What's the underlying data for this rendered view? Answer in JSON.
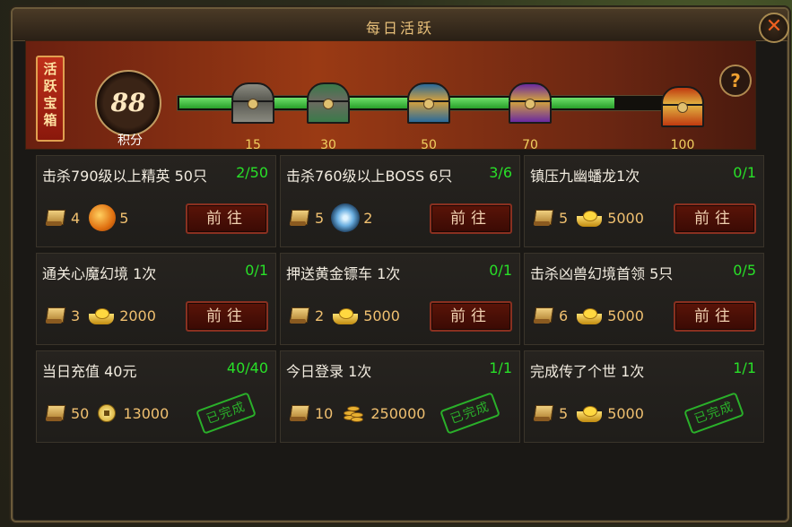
{
  "window": {
    "title": "每日活跃",
    "close_icon": "close-icon"
  },
  "banner": {
    "tag_text": "活跃宝箱",
    "points": "88",
    "points_label": "积分",
    "progress_fraction": 0.88,
    "milestones": [
      {
        "value": "15",
        "color": "#8a8a80",
        "accent": "#5a5a52"
      },
      {
        "value": "30",
        "color": "#3a7a4a",
        "accent": "#6a6a60"
      },
      {
        "value": "50",
        "color": "#2a6a9a",
        "accent": "#d0a040"
      },
      {
        "value": "70",
        "color": "#6a2aa0",
        "accent": "#d0a040"
      },
      {
        "value": "100",
        "color": "#c03a10",
        "accent": "#e0b040"
      }
    ],
    "help_label": "?"
  },
  "tasks": [
    {
      "name": "击杀790级以上精英 50只",
      "progress": "2/50",
      "rewards": [
        {
          "icon": "scroll-icon",
          "amount": "4"
        },
        {
          "icon": "fire-gem-icon",
          "amount": "5"
        }
      ],
      "action": "前往"
    },
    {
      "name": "击杀760级以上BOSS 6只",
      "progress": "3/6",
      "rewards": [
        {
          "icon": "scroll-icon",
          "amount": "5"
        },
        {
          "icon": "ice-gem-icon",
          "amount": "2"
        }
      ],
      "action": "前往"
    },
    {
      "name": "镇压九幽蟠龙1次",
      "progress": "0/1",
      "rewards": [
        {
          "icon": "scroll-icon",
          "amount": "5"
        },
        {
          "icon": "gold-ingot-icon",
          "amount": "5000"
        }
      ],
      "action": "前往"
    },
    {
      "name": "通关心魔幻境 1次",
      "progress": "0/1",
      "rewards": [
        {
          "icon": "scroll-icon",
          "amount": "3"
        },
        {
          "icon": "gold-ingot-icon",
          "amount": "2000"
        }
      ],
      "action": "前往"
    },
    {
      "name": "押送黄金镖车 1次",
      "progress": "0/1",
      "rewards": [
        {
          "icon": "scroll-icon",
          "amount": "2"
        },
        {
          "icon": "gold-ingot-icon",
          "amount": "5000"
        }
      ],
      "action": "前往"
    },
    {
      "name": "击杀凶兽幻境首领 5只",
      "progress": "0/5",
      "rewards": [
        {
          "icon": "scroll-icon",
          "amount": "6"
        },
        {
          "icon": "gold-ingot-icon",
          "amount": "5000"
        }
      ],
      "action": "前往"
    },
    {
      "name": "当日充值 40元",
      "progress": "40/40",
      "rewards": [
        {
          "icon": "scroll-icon",
          "amount": "50"
        },
        {
          "icon": "coin-icon",
          "amount": "13000"
        }
      ],
      "status": "已完成"
    },
    {
      "name": "今日登录 1次",
      "progress": "1/1",
      "rewards": [
        {
          "icon": "scroll-icon",
          "amount": "10"
        },
        {
          "icon": "coin-stack-icon",
          "amount": "250000"
        }
      ],
      "status": "已完成"
    },
    {
      "name": "完成传了个世 1次",
      "progress": "1/1",
      "rewards": [
        {
          "icon": "scroll-icon",
          "amount": "5"
        },
        {
          "icon": "gold-ingot-icon",
          "amount": "5000"
        }
      ],
      "status": "已完成"
    }
  ]
}
